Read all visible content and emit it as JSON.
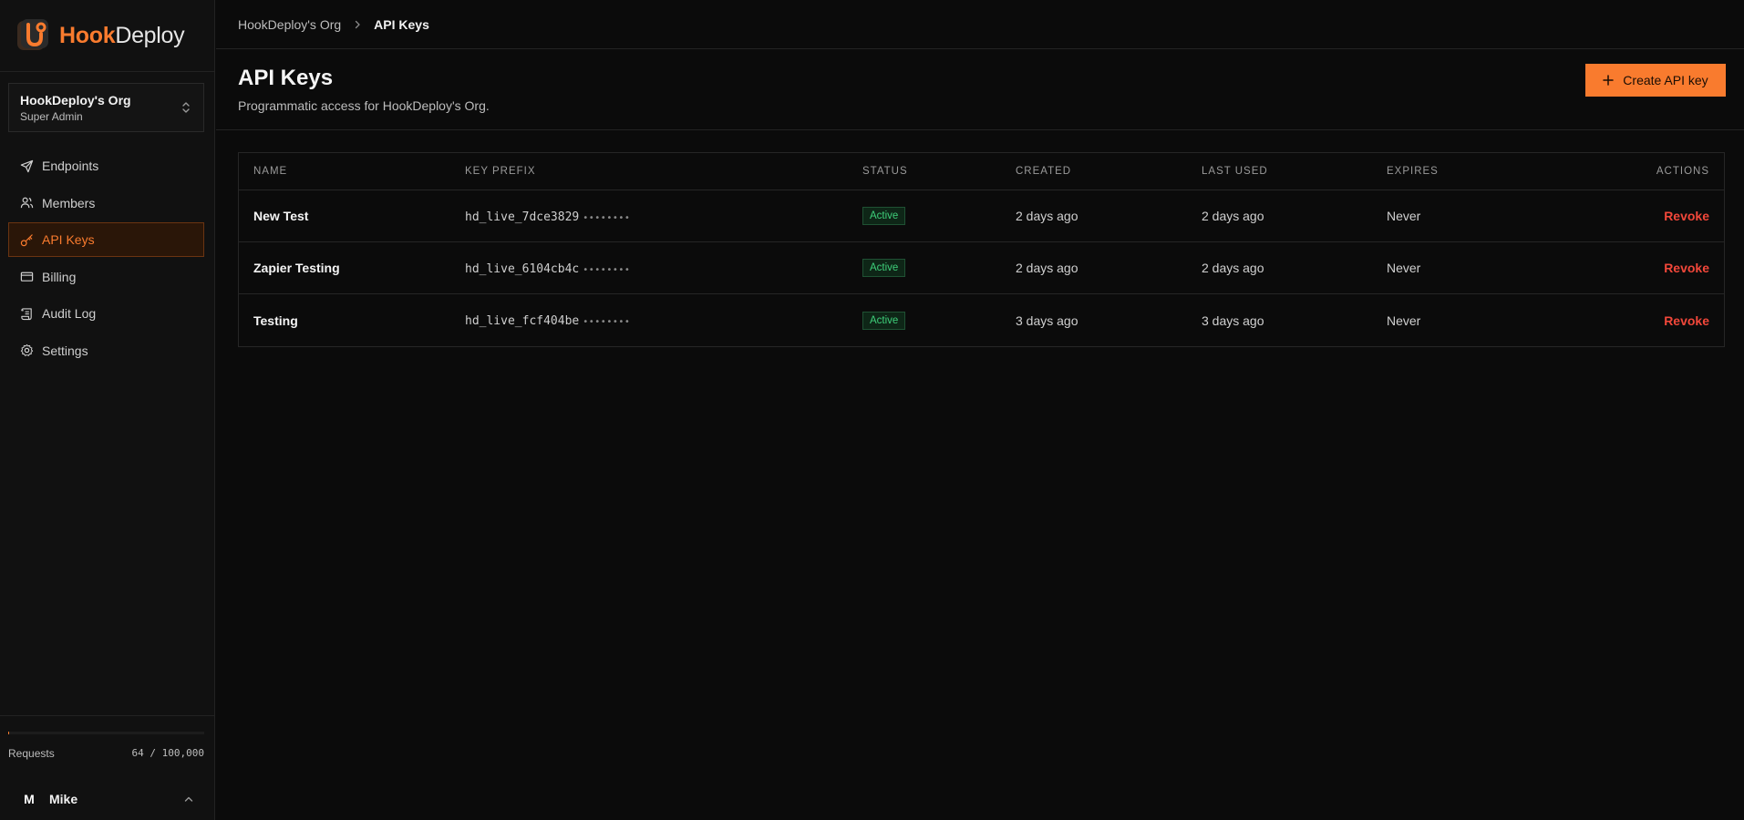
{
  "brand": {
    "part1": "Hook",
    "part2": "Deploy",
    "accent": "#f97b2e"
  },
  "org": {
    "name": "HookDeploy's Org",
    "role": "Super Admin"
  },
  "nav": [
    {
      "label": "Endpoints",
      "icon": "send-icon"
    },
    {
      "label": "Members",
      "icon": "users-icon"
    },
    {
      "label": "API Keys",
      "icon": "key-icon",
      "active": true
    },
    {
      "label": "Billing",
      "icon": "credit-card-icon"
    },
    {
      "label": "Audit Log",
      "icon": "scroll-icon"
    },
    {
      "label": "Settings",
      "icon": "gear-icon"
    }
  ],
  "usage": {
    "label": "Requests",
    "value": "64 / 100,000",
    "used": 64,
    "limit": 100000
  },
  "user": {
    "initial": "M",
    "name": "Mike"
  },
  "breadcrumb": {
    "parent": "HookDeploy's Org",
    "current": "API Keys"
  },
  "header": {
    "title": "API Keys",
    "subtitle": "Programmatic access for HookDeploy's Org.",
    "create_label": "Create API key"
  },
  "table": {
    "columns": [
      "NAME",
      "KEY PREFIX",
      "STATUS",
      "CREATED",
      "LAST USED",
      "EXPIRES",
      "ACTIONS"
    ],
    "rows": [
      {
        "name": "New Test",
        "prefix": "hd_live_7dce3829",
        "mask": "••••••••",
        "status": "Active",
        "created": "2 days ago",
        "last_used": "2 days ago",
        "expires": "Never",
        "action": "Revoke"
      },
      {
        "name": "Zapier Testing",
        "prefix": "hd_live_6104cb4c",
        "mask": "••••••••",
        "status": "Active",
        "created": "2 days ago",
        "last_used": "2 days ago",
        "expires": "Never",
        "action": "Revoke"
      },
      {
        "name": "Testing",
        "prefix": "hd_live_fcf404be",
        "mask": "••••••••",
        "status": "Active",
        "created": "3 days ago",
        "last_used": "3 days ago",
        "expires": "Never",
        "action": "Revoke"
      }
    ]
  }
}
